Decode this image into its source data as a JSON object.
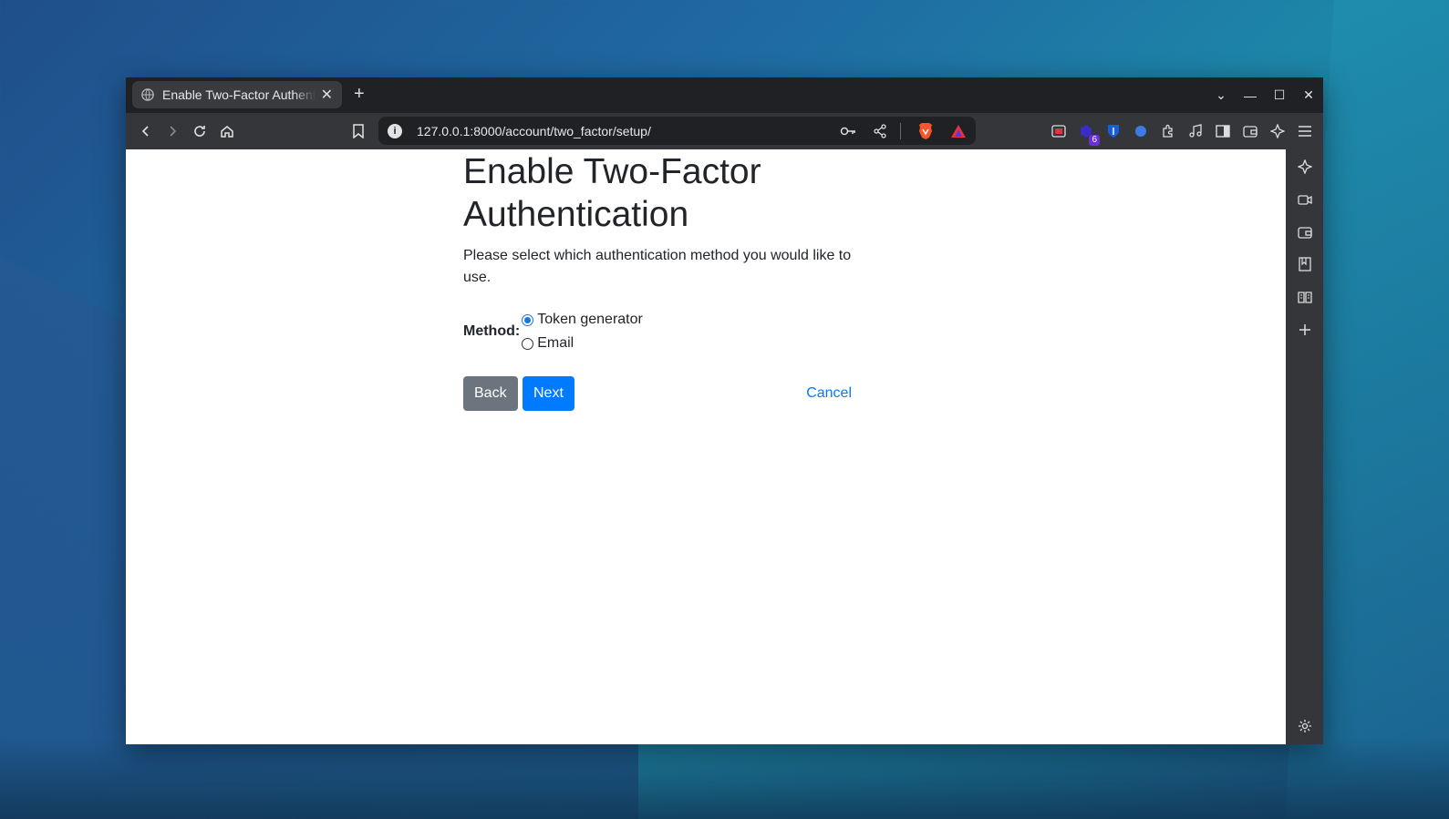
{
  "browser": {
    "tab_title": "Enable Two-Factor Authentication",
    "url": "127.0.0.1:8000/account/two_factor/setup/",
    "extension_badge": "6"
  },
  "page": {
    "heading": "Enable Two-Factor Authentication",
    "intro": "Please select which authentication method you would like to use.",
    "method_label": "Method:",
    "options": [
      {
        "label": "Token generator",
        "selected": true
      },
      {
        "label": "Email",
        "selected": false
      }
    ],
    "back_label": "Back",
    "next_label": "Next",
    "cancel_label": "Cancel"
  },
  "colors": {
    "primary": "#007bff",
    "secondary": "#6c757d"
  }
}
